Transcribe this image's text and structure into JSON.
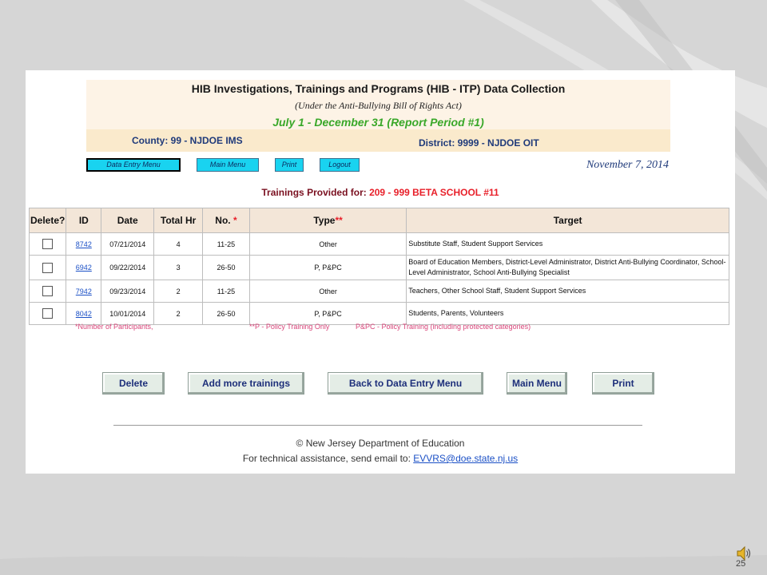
{
  "header": {
    "title": "HIB Investigations, Trainings and Programs (HIB - ITP) Data Collection",
    "subtitle": "(Under the Anti-Bullying Bill of Rights Act)",
    "period": "July 1 - December 31 (Report Period #1)",
    "county": "County: 99 - NJDOE IMS",
    "district": "District: 9999 - NJDOE OIT"
  },
  "nav": {
    "data_entry_menu": "Data Entry Menu",
    "main_menu": "Main Menu",
    "print": "Print",
    "logout": "Logout",
    "date": "November 7, 2014"
  },
  "section": {
    "label": "Trainings Provided for: ",
    "school": "209 - 999 BETA SCHOOL #11"
  },
  "table": {
    "headers": {
      "delete": "Delete?",
      "id": "ID",
      "date": "Date",
      "total_hr": "Total Hr",
      "no": "No.",
      "no_mark": "*",
      "type": "Type",
      "type_mark": "**",
      "target": "Target"
    },
    "rows": [
      {
        "id": "8742",
        "date": "07/21/2014",
        "total_hr": "4",
        "no": "11-25",
        "type": "Other",
        "target": "Substitute Staff, Student Support Services"
      },
      {
        "id": "6942",
        "date": "09/22/2014",
        "total_hr": "3",
        "no": "26-50",
        "type": "P, P&PC",
        "target": "Board of Education Members, District-Level Administrator, District Anti-Bullying Coordinator, School-Level Administrator, School Anti-Bullying Specialist"
      },
      {
        "id": "7942",
        "date": "09/23/2014",
        "total_hr": "2",
        "no": "11-25",
        "type": "Other",
        "target": "Teachers, Other School Staff, Student Support Services"
      },
      {
        "id": "8042",
        "date": "10/01/2014",
        "total_hr": "2",
        "no": "26-50",
        "type": "P, P&PC",
        "target": "Students, Parents, Volunteers"
      }
    ]
  },
  "footnotes": {
    "participants": "*Number of Participants,",
    "policy": "**P - Policy Training Only",
    "ppc": "P&PC - Policy Training (including protected categories)"
  },
  "actions": {
    "delete": "Delete",
    "add_more": "Add more trainings",
    "back": "Back to Data Entry Menu",
    "main_menu": "Main Menu",
    "print": "Print"
  },
  "footer": {
    "copyright": "© New Jersey Department of Education",
    "assist_text": "For technical assistance, send email to: ",
    "email": "EVVRS@doe.state.nj.us"
  },
  "slide": {
    "page_number": "25"
  },
  "colors": {
    "header_bg": "#fdf3e6",
    "period_green": "#3aa82a",
    "nav_cyan": "#19d3f0",
    "school_red": "#e8202a",
    "footnote_pink": "#d9457a",
    "link_blue": "#1b50c6"
  }
}
